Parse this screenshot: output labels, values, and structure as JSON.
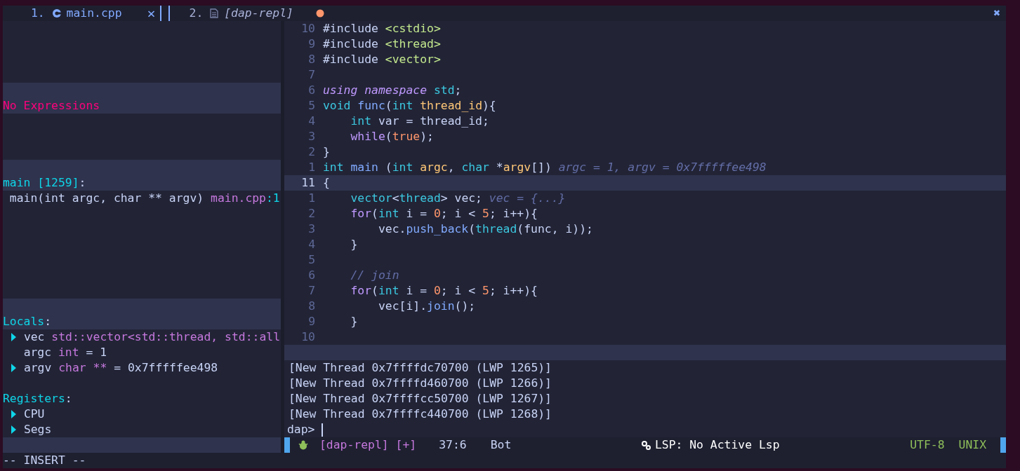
{
  "tabline": {
    "tabs": [
      {
        "number": "1.",
        "label": "main.cpp",
        "selected": true,
        "close": "×"
      },
      {
        "number": "2.",
        "label": "[dap-repl]",
        "selected": false,
        "modified": true
      }
    ],
    "close_all": "✖"
  },
  "dap_ui": {
    "lines": [
      {
        "kind": "blank"
      },
      {
        "kind": "blank"
      },
      {
        "kind": "blank"
      },
      {
        "kind": "blank"
      },
      {
        "kind": "bar"
      },
      {
        "kind": "title",
        "segments": [
          {
            "text": "No Expressions",
            "kind": "error"
          }
        ]
      },
      {
        "kind": "blank"
      },
      {
        "kind": "blank"
      },
      {
        "kind": "blank"
      },
      {
        "kind": "bar"
      },
      {
        "kind": "title",
        "segments": [
          {
            "text": "main [1259]",
            "kind": "heading"
          },
          {
            "text": ":",
            "kind": "plain"
          }
        ]
      },
      {
        "kind": "frame",
        "segments": [
          {
            "text": "main(int argc, char ** argv)",
            "kind": "plain"
          },
          {
            "text": " main.cpp",
            "kind": "type"
          },
          {
            "text": ":1",
            "kind": "heading"
          }
        ]
      },
      {
        "kind": "blank"
      },
      {
        "kind": "blank"
      },
      {
        "kind": "blank"
      },
      {
        "kind": "blank"
      },
      {
        "kind": "blank"
      },
      {
        "kind": "blank"
      },
      {
        "kind": "bar"
      },
      {
        "kind": "title",
        "segments": [
          {
            "text": "Locals",
            "kind": "heading"
          },
          {
            "text": ":",
            "kind": "plain"
          }
        ]
      },
      {
        "kind": "node",
        "expandable": true,
        "expanded": false,
        "segments": [
          {
            "text": "vec",
            "kind": "plain"
          },
          {
            "text": " std::vector<std::thread, std::all",
            "kind": "type"
          }
        ]
      },
      {
        "kind": "node",
        "expandable": false,
        "segments": [
          {
            "text": "argc",
            "kind": "plain"
          },
          {
            "text": " int",
            "kind": "type"
          },
          {
            "text": " = 1",
            "kind": "plain"
          }
        ]
      },
      {
        "kind": "node",
        "expandable": true,
        "expanded": false,
        "segments": [
          {
            "text": "argv",
            "kind": "plain"
          },
          {
            "text": " char **",
            "kind": "type"
          },
          {
            "text": " = 0x7fffffee498",
            "kind": "plain"
          }
        ]
      },
      {
        "kind": "blank"
      },
      {
        "kind": "text",
        "segments": [
          {
            "text": "Registers",
            "kind": "heading"
          },
          {
            "text": ":",
            "kind": "plain"
          }
        ]
      },
      {
        "kind": "node",
        "expandable": true,
        "expanded": false,
        "segments": [
          {
            "text": "CPU",
            "kind": "plain"
          }
        ]
      },
      {
        "kind": "node",
        "expandable": true,
        "expanded": false,
        "segments": [
          {
            "text": "Segs",
            "kind": "plain"
          }
        ]
      },
      {
        "kind": "bar"
      }
    ]
  },
  "editor": {
    "lines": [
      {
        "number": "10",
        "current": false,
        "tokens": [
          {
            "text": "#include ",
            "kind": "plain"
          },
          {
            "text": "<cstdio>",
            "kind": "string"
          }
        ]
      },
      {
        "number": "9",
        "current": false,
        "tokens": [
          {
            "text": "#include ",
            "kind": "plain"
          },
          {
            "text": "<thread>",
            "kind": "string"
          }
        ]
      },
      {
        "number": "8",
        "current": false,
        "tokens": [
          {
            "text": "#include ",
            "kind": "plain"
          },
          {
            "text": "<vector>",
            "kind": "string"
          }
        ]
      },
      {
        "number": "7",
        "current": false
      },
      {
        "number": "6",
        "current": false,
        "tokens": [
          {
            "text": "using namespace ",
            "kind": "storage"
          },
          {
            "text": "std",
            "kind": "type"
          },
          {
            "text": ";",
            "kind": "plain"
          }
        ]
      },
      {
        "number": "5",
        "current": false,
        "tokens": [
          {
            "text": "void ",
            "kind": "type"
          },
          {
            "text": "func",
            "kind": "function"
          },
          {
            "text": "(",
            "kind": "plain"
          },
          {
            "text": "int ",
            "kind": "type"
          },
          {
            "text": "thread_id",
            "kind": "param"
          },
          {
            "text": "){",
            "kind": "plain"
          }
        ]
      },
      {
        "number": "4",
        "current": false,
        "tokens": [
          {
            "text": "    int",
            "kind": "type"
          },
          {
            "text": " var = thread_id;",
            "kind": "plain"
          }
        ]
      },
      {
        "number": "3",
        "current": false,
        "tokens": [
          {
            "text": "    while",
            "kind": "keyword"
          },
          {
            "text": "(",
            "kind": "plain"
          },
          {
            "text": "true",
            "kind": "number"
          },
          {
            "text": ");",
            "kind": "plain"
          }
        ]
      },
      {
        "number": "2",
        "current": false,
        "tokens": [
          {
            "text": "}",
            "kind": "plain"
          }
        ]
      },
      {
        "number": "1",
        "current": false,
        "tokens": [
          {
            "text": "int ",
            "kind": "type"
          },
          {
            "text": "main",
            "kind": "function"
          },
          {
            "text": " (",
            "kind": "plain"
          },
          {
            "text": "int ",
            "kind": "type"
          },
          {
            "text": "argc",
            "kind": "param"
          },
          {
            "text": ", ",
            "kind": "plain"
          },
          {
            "text": "char",
            "kind": "type"
          },
          {
            "text": " *",
            "kind": "plain"
          },
          {
            "text": "argv",
            "kind": "param"
          },
          {
            "text": "[])",
            "kind": "plain"
          },
          {
            "text": " argc = 1, argv = 0x7fffffee498",
            "kind": "hint"
          }
        ]
      },
      {
        "number": "11",
        "current": true,
        "tokens": [
          {
            "text": "{",
            "kind": "plain"
          }
        ]
      },
      {
        "number": "1",
        "current": false,
        "tokens": [
          {
            "text": "    vector",
            "kind": "type"
          },
          {
            "text": "<",
            "kind": "plain"
          },
          {
            "text": "thread",
            "kind": "type"
          },
          {
            "text": "> vec;",
            "kind": "plain"
          },
          {
            "text": " vec = {...}",
            "kind": "hint"
          }
        ]
      },
      {
        "number": "2",
        "current": false,
        "tokens": [
          {
            "text": "    for",
            "kind": "keyword"
          },
          {
            "text": "(",
            "kind": "plain"
          },
          {
            "text": "int",
            "kind": "type"
          },
          {
            "text": " i = ",
            "kind": "plain"
          },
          {
            "text": "0",
            "kind": "number"
          },
          {
            "text": "; i < ",
            "kind": "plain"
          },
          {
            "text": "5",
            "kind": "number"
          },
          {
            "text": "; i++){",
            "kind": "plain"
          }
        ]
      },
      {
        "number": "3",
        "current": false,
        "tokens": [
          {
            "text": "        vec.",
            "kind": "plain"
          },
          {
            "text": "push_back",
            "kind": "function"
          },
          {
            "text": "(",
            "kind": "plain"
          },
          {
            "text": "thread",
            "kind": "type"
          },
          {
            "text": "(func, i));",
            "kind": "plain"
          }
        ]
      },
      {
        "number": "4",
        "current": false,
        "tokens": [
          {
            "text": "    }",
            "kind": "plain"
          }
        ]
      },
      {
        "number": "5",
        "current": false
      },
      {
        "number": "6",
        "current": false,
        "tokens": [
          {
            "text": "    // join",
            "kind": "comment"
          }
        ]
      },
      {
        "number": "7",
        "current": false,
        "tokens": [
          {
            "text": "    for",
            "kind": "keyword"
          },
          {
            "text": "(",
            "kind": "plain"
          },
          {
            "text": "int",
            "kind": "type"
          },
          {
            "text": " i = ",
            "kind": "plain"
          },
          {
            "text": "0",
            "kind": "number"
          },
          {
            "text": "; i < ",
            "kind": "plain"
          },
          {
            "text": "5",
            "kind": "number"
          },
          {
            "text": "; i++){",
            "kind": "plain"
          }
        ]
      },
      {
        "number": "8",
        "current": false,
        "tokens": [
          {
            "text": "        vec[i].",
            "kind": "plain"
          },
          {
            "text": "join",
            "kind": "function"
          },
          {
            "text": "();",
            "kind": "plain"
          }
        ]
      },
      {
        "number": "9",
        "current": false,
        "tokens": [
          {
            "text": "    }",
            "kind": "plain"
          }
        ]
      },
      {
        "number": "10",
        "current": false
      }
    ]
  },
  "repl": {
    "output": [
      "[New Thread 0x7ffffdc70700 (LWP 1265)]",
      "[New Thread 0x7ffffd460700 (LWP 1266)]",
      "[New Thread 0x7ffffcc50700 (LWP 1267)]",
      "[New Thread 0x7ffffc440700 (LWP 1268)]"
    ],
    "prompt": "dap>"
  },
  "status_bar": {
    "buffer": "[dap-repl]",
    "modified_flag": "[+]",
    "position": "37:6",
    "scroll": "Bot",
    "lsp": "LSP: No Active Lsp",
    "encoding": "UTF-8",
    "format": "UNIX"
  },
  "command_line": {
    "mode": "-- INSERT --"
  }
}
